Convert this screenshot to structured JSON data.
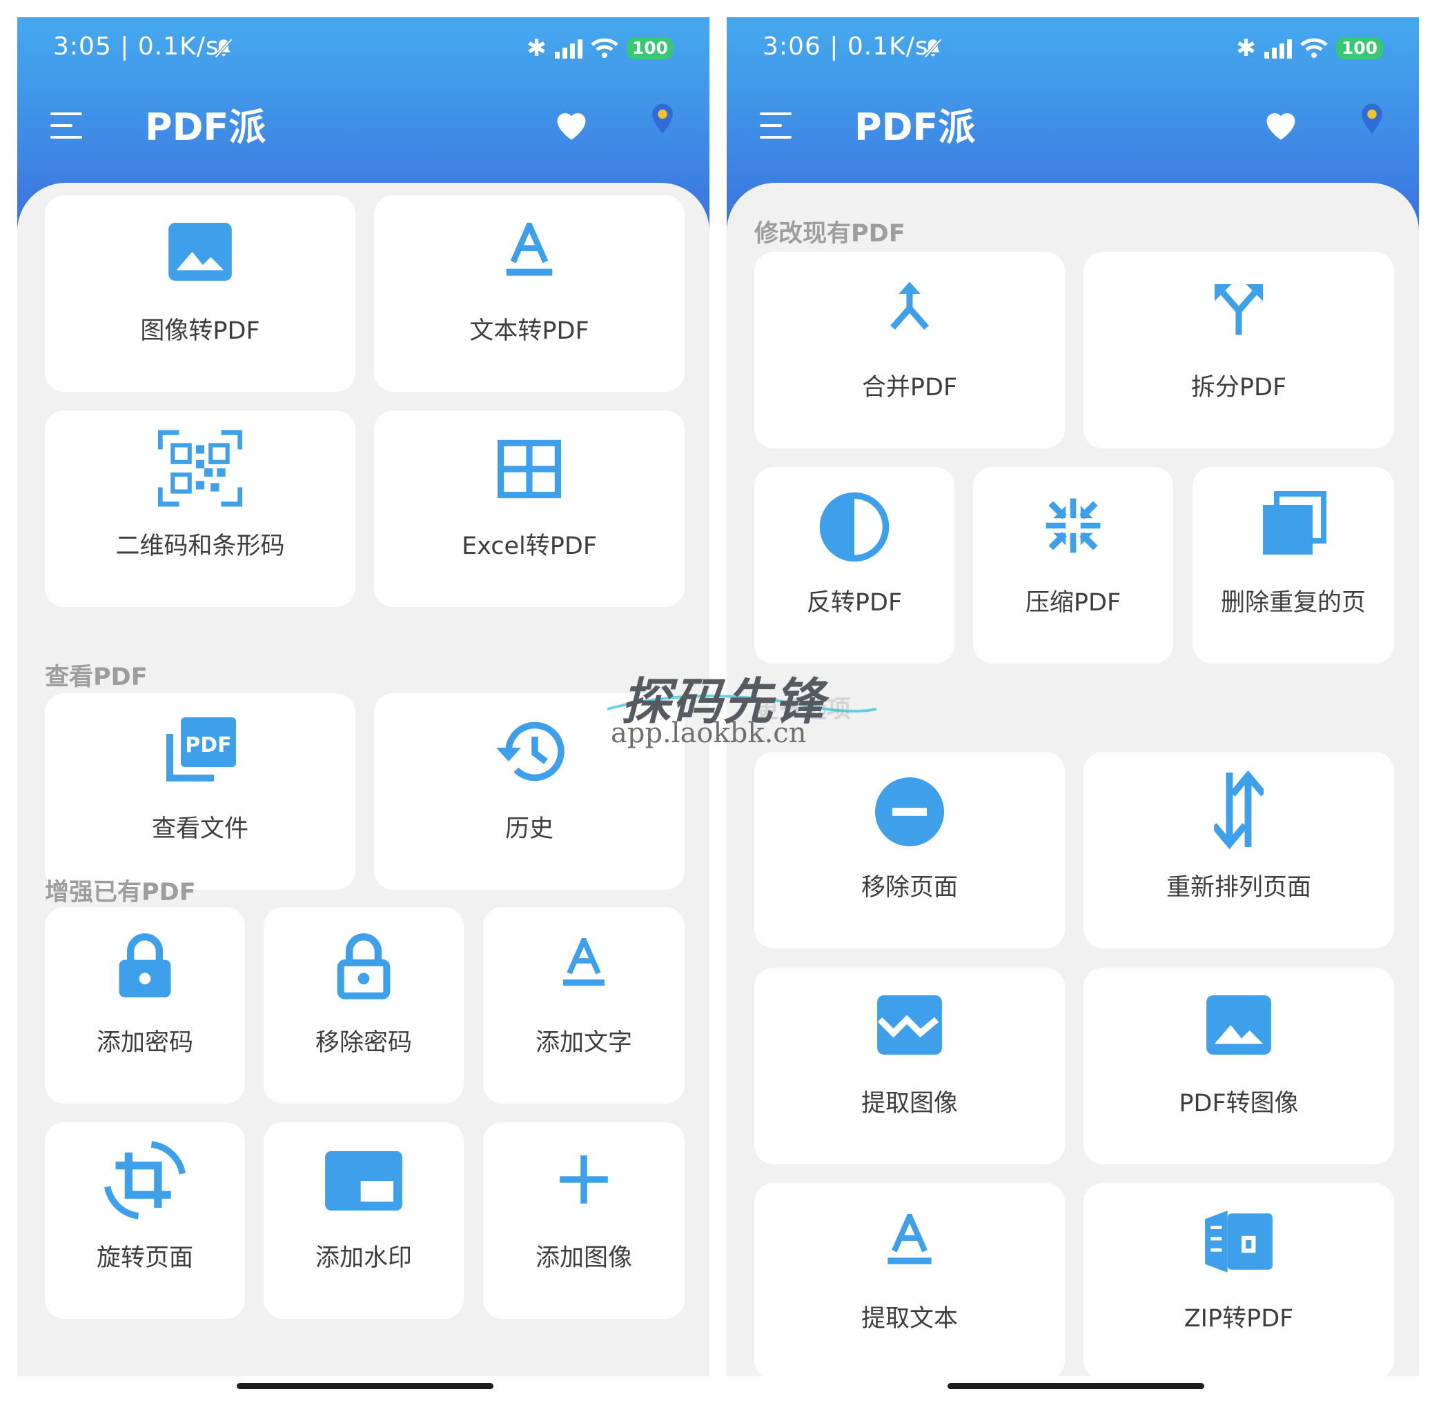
{
  "colors": {
    "accent": "#3ea0ea",
    "header_top": "#45a9ee",
    "header_bottom": "#3a6fde",
    "background": "#f1f1f1",
    "card": "#ffffff",
    "battery": "#37c873"
  },
  "left": {
    "status": {
      "time": "3:05 | 0.1K/s",
      "battery": "100"
    },
    "app_title": "PDF派",
    "sections": {
      "view": "查看PDF",
      "enhance": "增强已有PDF"
    },
    "tools": {
      "image_to_pdf": "图像转PDF",
      "text_to_pdf": "文本转PDF",
      "qr_barcode": "二维码和条形码",
      "excel_to_pdf": "Excel转PDF",
      "view_files": "查看文件",
      "history": "历史",
      "add_password": "添加密码",
      "remove_password": "移除密码",
      "add_text": "添加文字",
      "rotate_pages": "旋转页面",
      "add_watermark": "添加水印",
      "add_image": "添加图像"
    }
  },
  "right": {
    "status": {
      "time": "3:06 | 0.1K/s",
      "battery": "100"
    },
    "app_title": "PDF派",
    "sections": {
      "modify": "修改现有PDF",
      "more": "更多选项"
    },
    "tools": {
      "merge": "合并PDF",
      "split": "拆分PDF",
      "invert": "反转PDF",
      "compress": "压缩PDF",
      "delete_duplicates": "删除重复的页",
      "remove_pages": "移除页面",
      "reorder_pages": "重新排列页面",
      "extract_images": "提取图像",
      "pdf_to_image": "PDF转图像",
      "extract_text": "提取文本",
      "zip_to_pdf": "ZIP转PDF"
    }
  },
  "watermark": {
    "title": "探码先锋",
    "url": "app.laokbk.cn"
  }
}
